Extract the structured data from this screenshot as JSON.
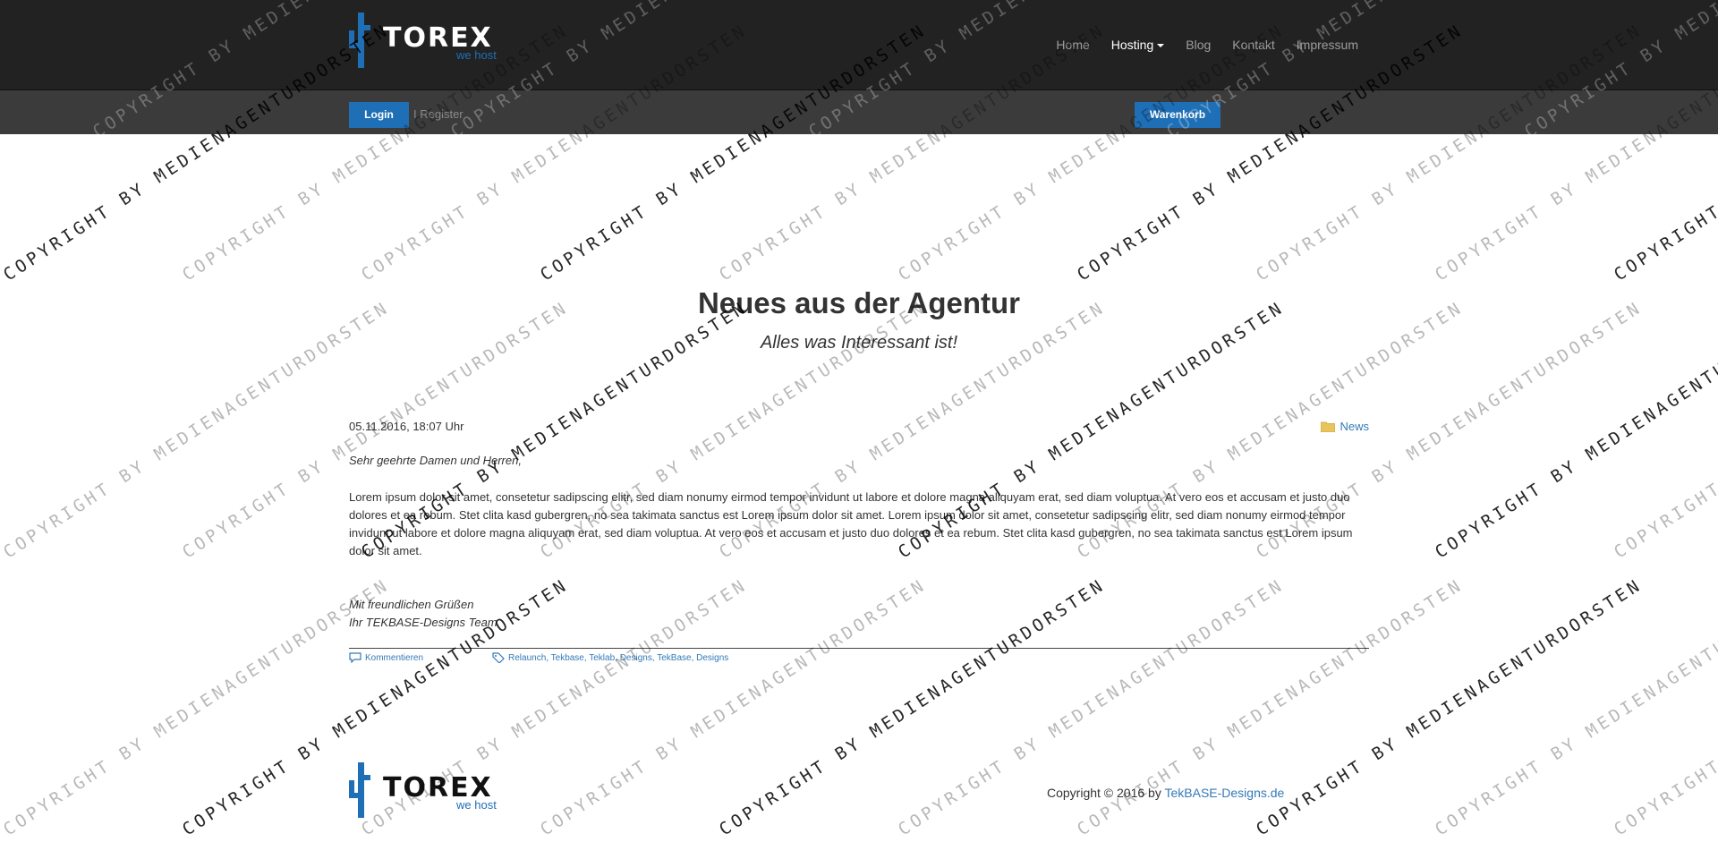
{
  "brand": {
    "name": "TOREX",
    "tagline": "we host",
    "colors": {
      "text": "#ffffff",
      "accent": "#1f6fb6",
      "footer_text": "#111111"
    }
  },
  "nav": {
    "items": [
      {
        "label": "Home"
      },
      {
        "label": "Hosting",
        "active": true,
        "dropdown": true
      },
      {
        "label": "Blog"
      },
      {
        "label": "Kontakt"
      },
      {
        "label": "Impressum"
      }
    ]
  },
  "subbar": {
    "login_label": "Login",
    "register_label": "I Register",
    "cart_label": "Warenkorb"
  },
  "main": {
    "title": "Neues aus der Agentur",
    "subtitle": "Alles was Interessant ist!"
  },
  "post": {
    "date": "05.11.2016, 18:07 Uhr",
    "category": "News",
    "salutation": "Sehr geehrte Damen und Herren,",
    "body": "Lorem ipsum dolor sit amet, consetetur sadipscing elitr, sed diam nonumy eirmod tempor invidunt ut labore et dolore magna aliquyam erat, sed diam voluptua. At vero eos et accusam et justo duo dolores et ea rebum. Stet clita kasd gubergren, no sea takimata sanctus est Lorem ipsum dolor sit amet. Lorem ipsum dolor sit amet, consetetur sadipscing elitr, sed diam nonumy eirmod tempor invidunt ut labore et dolore magna aliquyam erat, sed diam voluptua. At vero eos et accusam et justo duo dolores et ea rebum. Stet clita kasd gubergren, no sea takimata sanctus est Lorem ipsum dolor sit amet.",
    "closing_line1": "Mit freundlichen Grüßen",
    "closing_line2": "Ihr TEKBASE-Designs Team",
    "comments_label": "Kommentieren",
    "tags_label": "Relaunch, Tekbase, Teklab, Designs, TekBase, Designs",
    "icons": {
      "category": "folder-icon",
      "comments": "comment-icon",
      "tags": "tag-icon"
    }
  },
  "footer": {
    "copyright_prefix": "Copyright © 2016 by",
    "copyright_link": "TekBASE-Designs.de"
  },
  "watermark": {
    "text_copyright": "COPYRIGHT BY MEDIENAGENTURDORSTEN"
  },
  "colors": {
    "navbar_bg": "#222222",
    "subbar_bg": "#3b3b3b",
    "button_blue": "#1f6fb6",
    "link_blue": "#337ab7"
  }
}
